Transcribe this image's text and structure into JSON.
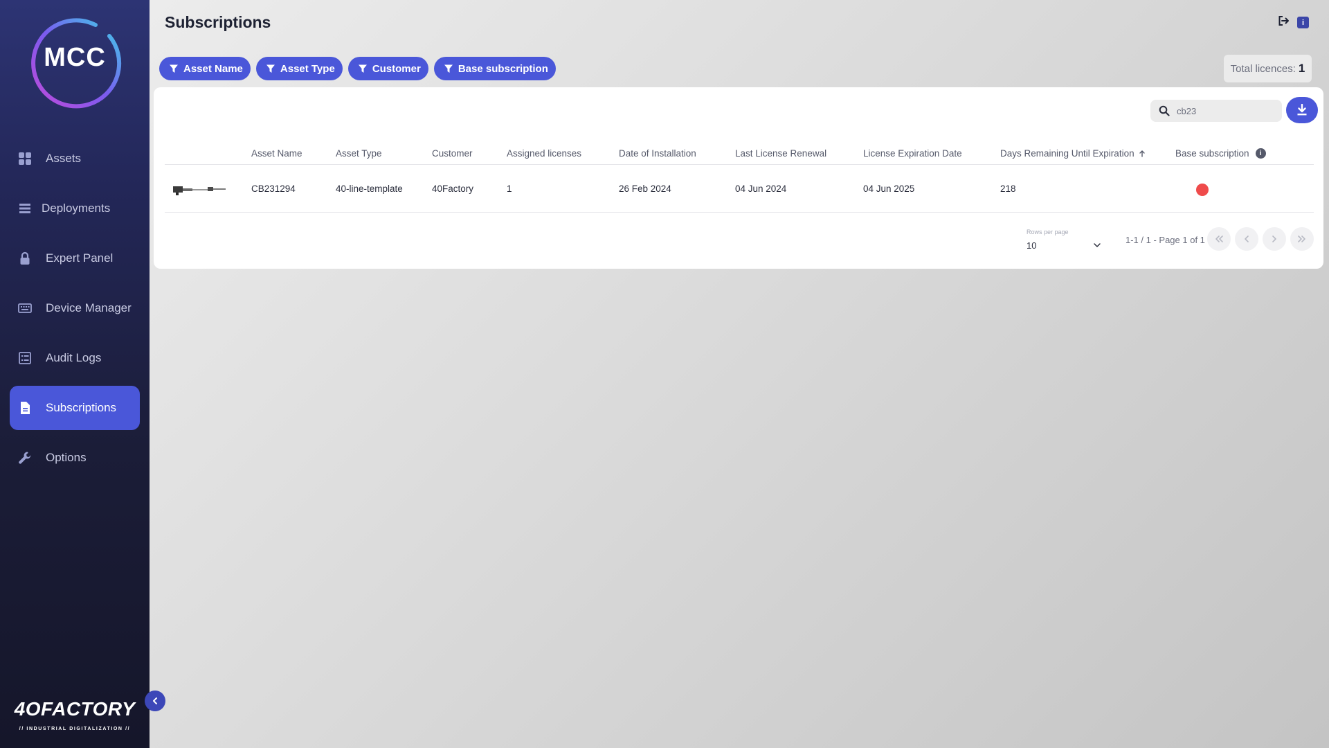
{
  "app": {
    "logo_text": "MCC",
    "brand_name": "4OFACTORY",
    "brand_tagline": "// INDUSTRIAL DIGITALIZATION //"
  },
  "sidebar": {
    "items": [
      {
        "label": "Assets",
        "icon": "grid-icon"
      },
      {
        "label": "Deployments",
        "icon": "server-icon"
      },
      {
        "label": "Expert Panel",
        "icon": "lock-icon"
      },
      {
        "label": "Device Manager",
        "icon": "keyboard-icon"
      },
      {
        "label": "Audit Logs",
        "icon": "list-icon"
      },
      {
        "label": "Subscriptions",
        "icon": "document-icon",
        "active": true
      },
      {
        "label": "Options",
        "icon": "wrench-icon"
      }
    ]
  },
  "header": {
    "title": "Subscriptions"
  },
  "filters": [
    "Asset Name",
    "Asset Type",
    "Customer",
    "Base subscription"
  ],
  "total": {
    "label": "Total licences:",
    "value": "1"
  },
  "search": {
    "value": "cb23"
  },
  "table": {
    "columns": [
      "Asset Name",
      "Asset Type",
      "Customer",
      "Assigned licenses",
      "Date of Installation",
      "Last License Renewal",
      "License Expiration Date",
      "Days Remaining Until Expiration",
      "Base subscription"
    ],
    "rows": [
      {
        "asset_name": "CB231294",
        "asset_type": "40-line-template",
        "customer": "40Factory",
        "assigned": "1",
        "installed": "26 Feb 2024",
        "renewal": "04 Jun 2024",
        "expiration": "04 Jun 2025",
        "days_remaining": "218",
        "base_subscription_status": "inactive"
      }
    ]
  },
  "pagination": {
    "rows_per_page_label": "Rows per page",
    "rows_per_page": "10",
    "range": "1-1 / 1 - Page 1 of 1"
  },
  "colors": {
    "accent": "#4a57d9",
    "status_red": "#ef4b4b",
    "sidebar_dark": "#15162a"
  }
}
